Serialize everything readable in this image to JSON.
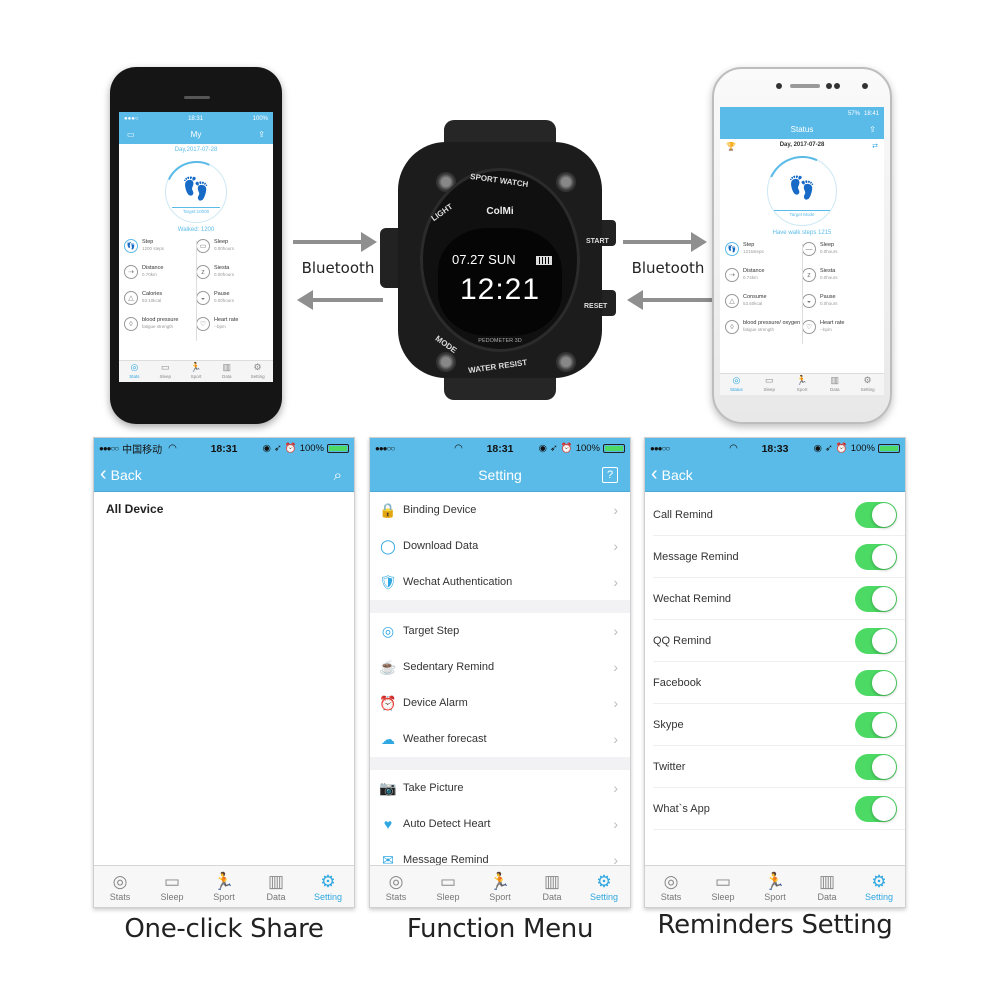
{
  "colors": {
    "accent": "#5bbbe8",
    "toggle_on": "#4cd964",
    "icon_blue": "#2fa7e0"
  },
  "connection": {
    "left_label": "Bluetooth",
    "right_label": "Bluetooth"
  },
  "iphone_app": {
    "status_time": "18:31",
    "status_battery": "100%",
    "title": "My",
    "date": "Day,2017-07-28",
    "ring_label": "Target:10000",
    "walked": "Walked: 1200",
    "stats": [
      {
        "title": "Step",
        "value": "1200 steps",
        "icon": "footprints-icon",
        "glyph": "👣"
      },
      {
        "title": "Sleep",
        "value": "0.00hours",
        "icon": "sleep-icon",
        "glyph": "▭"
      },
      {
        "title": "Distance",
        "value": "0.70km",
        "icon": "distance-icon",
        "glyph": "⇢"
      },
      {
        "title": "Siesta",
        "value": "0.00hours",
        "icon": "siesta-icon",
        "glyph": "z"
      },
      {
        "title": "Calories",
        "value": "53.10kcal",
        "icon": "calories-icon",
        "glyph": "△"
      },
      {
        "title": "Pause",
        "value": "0.00hours",
        "icon": "pause-icon",
        "glyph": "◒"
      },
      {
        "title": "blood pressure",
        "value": "fatigue strength",
        "icon": "blood-drop-icon",
        "glyph": "◊"
      },
      {
        "title": "Heart rate",
        "value": "--bpm",
        "icon": "heart-rate-icon",
        "glyph": "♡"
      }
    ],
    "tabs": [
      "Stats",
      "Sleep",
      "Sport",
      "Data",
      "Setting"
    ]
  },
  "watch": {
    "brand": "ColMi",
    "date": "07.27 SUN",
    "time": "12:21",
    "footer": "PEDOMETER 3D",
    "bezel_top": "SPORT WATCH",
    "bezel_bottom": "WATER RESIST",
    "buttons": {
      "light": "LIGHT",
      "mode": "MODE",
      "start": "START",
      "reset": "RESET"
    }
  },
  "android_app": {
    "status_battery": "57%",
    "status_time": "18:41",
    "title": "Status",
    "date": "Day, 2017-07-28",
    "ring_label": "Target Mode",
    "walked": "Have walk steps 1215",
    "stats": [
      {
        "title": "Step",
        "value": "1215steps",
        "icon": "footprints-icon",
        "glyph": "👣"
      },
      {
        "title": "Sleep",
        "value": "0.0hours",
        "icon": "sleep-icon",
        "glyph": "—"
      },
      {
        "title": "Distance",
        "value": "0.74km",
        "icon": "distance-icon",
        "glyph": "⇢"
      },
      {
        "title": "Siesta",
        "value": "0.0hours",
        "icon": "siesta-icon",
        "glyph": "z"
      },
      {
        "title": "Consume",
        "value": "53.60kcal",
        "icon": "calories-icon",
        "glyph": "△"
      },
      {
        "title": "Pause",
        "value": "0.0hours",
        "icon": "pause-icon",
        "glyph": "◒"
      },
      {
        "title": "blood pressure/ oxygen",
        "value": "fatigue strength",
        "icon": "blood-drop-icon",
        "glyph": "◊"
      },
      {
        "title": "Heart rate",
        "value": "--bpm",
        "icon": "heart-rate-icon",
        "glyph": "♡"
      }
    ],
    "tabs": [
      "Status",
      "Sleep",
      "Sport",
      "Data",
      "Setting"
    ]
  },
  "screens": [
    {
      "caption": "One-click Share",
      "status": {
        "carrier": "中国移动",
        "time": "18:31",
        "battery": "100%"
      },
      "nav": {
        "back": "Back",
        "action_icon": "search-icon"
      },
      "section_title": "All Device"
    },
    {
      "caption": "Function Menu",
      "status": {
        "time": "18:31",
        "battery": "100%"
      },
      "nav": {
        "title": "Setting",
        "action_icon": "help-icon",
        "action_glyph": "?"
      },
      "groups": [
        [
          {
            "label": "Binding Device",
            "icon": "lock-rotate-icon",
            "glyph": "🔒"
          },
          {
            "label": "Download Data",
            "icon": "sync-circle-icon",
            "glyph": "◯"
          },
          {
            "label": "Wechat Authentication",
            "icon": "shield-chat-icon",
            "glyph": "🛡"
          }
        ],
        [
          {
            "label": "Target Step",
            "icon": "target-icon",
            "glyph": "◎"
          },
          {
            "label": "Sedentary Remind",
            "icon": "coffee-cup-icon",
            "glyph": "☕"
          },
          {
            "label": "Device Alarm",
            "icon": "alarm-clock-icon",
            "glyph": "⏰"
          },
          {
            "label": "Weather forecast",
            "icon": "weather-cloud-icon",
            "glyph": "☁"
          }
        ],
        [
          {
            "label": "Take Picture",
            "icon": "camera-search-icon",
            "glyph": "📷"
          },
          {
            "label": "Auto Detect Heart",
            "icon": "heart-icon",
            "glyph": "♥"
          },
          {
            "label": "Message Remind",
            "icon": "envelope-icon",
            "glyph": "✉"
          }
        ]
      ]
    },
    {
      "caption": "Reminders Setting",
      "status": {
        "time": "18:33",
        "battery": "100%"
      },
      "nav": {
        "back": "Back"
      },
      "toggles": [
        {
          "label": "Call Remind",
          "on": true
        },
        {
          "label": "Message Remind",
          "on": true
        },
        {
          "label": "Wechat Remind",
          "on": true
        },
        {
          "label": "QQ Remind",
          "on": true
        },
        {
          "label": "Facebook",
          "on": true
        },
        {
          "label": "Skype",
          "on": true
        },
        {
          "label": "Twitter",
          "on": true
        },
        {
          "label": "What`s App",
          "on": true
        }
      ]
    }
  ],
  "tabbar": {
    "active": "Setting",
    "tabs": [
      {
        "label": "Stats",
        "icon": "stats-icon",
        "glyph": "◎"
      },
      {
        "label": "Sleep",
        "icon": "bed-icon",
        "glyph": "▭"
      },
      {
        "label": "Sport",
        "icon": "runner-icon",
        "glyph": "🏃"
      },
      {
        "label": "Data",
        "icon": "bar-chart-icon",
        "glyph": "▥"
      },
      {
        "label": "Setting",
        "icon": "gear-icon",
        "glyph": "⚙"
      }
    ]
  }
}
